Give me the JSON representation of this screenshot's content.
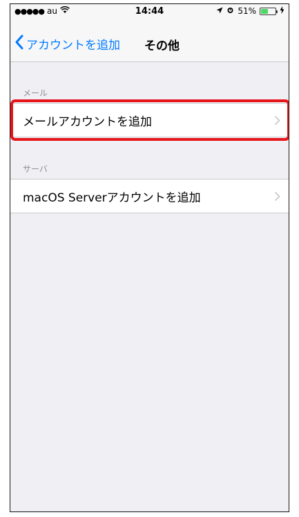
{
  "status_bar": {
    "signal": "●●●●●",
    "carrier": "au",
    "time": "14:44",
    "battery_pct": "51%",
    "battery_level": 0.51
  },
  "nav": {
    "back_label": "アカウントを追加",
    "title": "その他"
  },
  "sections": [
    {
      "header": "メール",
      "items": [
        {
          "label": "メールアカウントを追加"
        }
      ]
    },
    {
      "header": "サーバ",
      "items": [
        {
          "label": "macOS Serverアカウントを追加"
        }
      ]
    }
  ],
  "colors": {
    "accent": "#007aff",
    "highlight": "#e8141b",
    "background": "#efeff4"
  }
}
